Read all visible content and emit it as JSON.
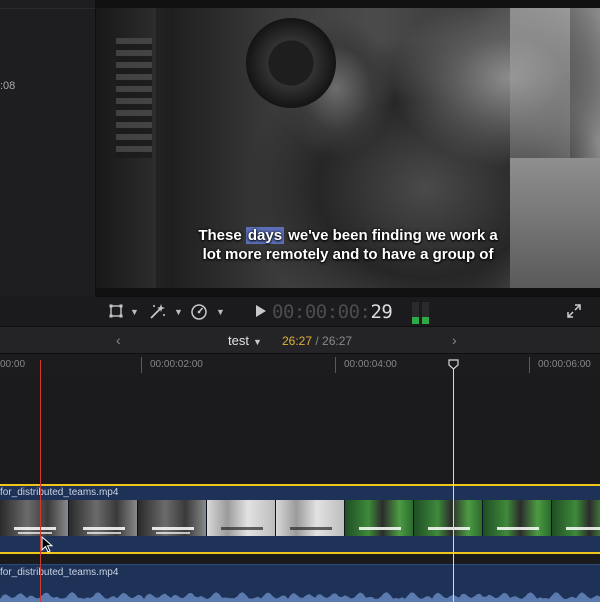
{
  "inspector": {
    "timecode_fragment": ":08"
  },
  "viewer": {
    "caption_line1_word1": "These ",
    "caption_line1_highlight": "days",
    "caption_line1_rest": " we've been finding we work a",
    "caption_line2": "lot more remotely and to have a group of"
  },
  "toolbar": {
    "transform_icon": "crop-transform-icon",
    "enhance_icon": "magic-wand-icon",
    "speed_icon": "speed-gauge-icon",
    "play_icon": "play-icon",
    "timecode_dim": "00:00:00:",
    "timecode_bright": "29",
    "fullscreen_icon": "fullscreen-icon",
    "audio_meter_level": 0.3,
    "accent_green": "#2fa84a"
  },
  "timeline_header": {
    "prev": "‹",
    "next": "›",
    "project_name": "test",
    "current_duration": "26:27",
    "separator": " / ",
    "total_duration": "26:27",
    "accent_yellow": "#e0b13a"
  },
  "ruler": {
    "marks": [
      "00:00",
      "00:00:02:00",
      "00:00:04:00",
      "00:00:06:00"
    ]
  },
  "tracks": {
    "video_clip_name": "for_distributed_teams.mp4",
    "audio_clip_name": "for_distributed_teams.mp4",
    "selection_color": "#f0c419",
    "clip_color": "#1d3256"
  }
}
